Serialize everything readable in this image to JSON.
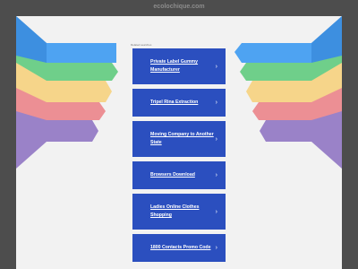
{
  "site": {
    "domain": "ecolochique.com"
  },
  "ads": {
    "label": "Related searches",
    "links": [
      {
        "label": "Private Label Gummy Manufacturer"
      },
      {
        "label": "Tripel Rina Extraction"
      },
      {
        "label": "Moving Company to Another State"
      },
      {
        "label": "Browsers Download"
      },
      {
        "label": "Ladies Online Clothes Shopping"
      },
      {
        "label": "1800 Contacts Promo Code"
      }
    ]
  },
  "colors": {
    "background": "#4d4d4d",
    "page": "#f2f2f2",
    "link_bg": "#2b4fbf",
    "ribbon_blue": "#4ea3f2",
    "ribbon_green": "#6fcf8a",
    "ribbon_yellow": "#f6d58a",
    "ribbon_red": "#ec8f94",
    "ribbon_purple": "#9a82c8"
  },
  "icons": {
    "link_arrow": "chevron-right-icon"
  }
}
